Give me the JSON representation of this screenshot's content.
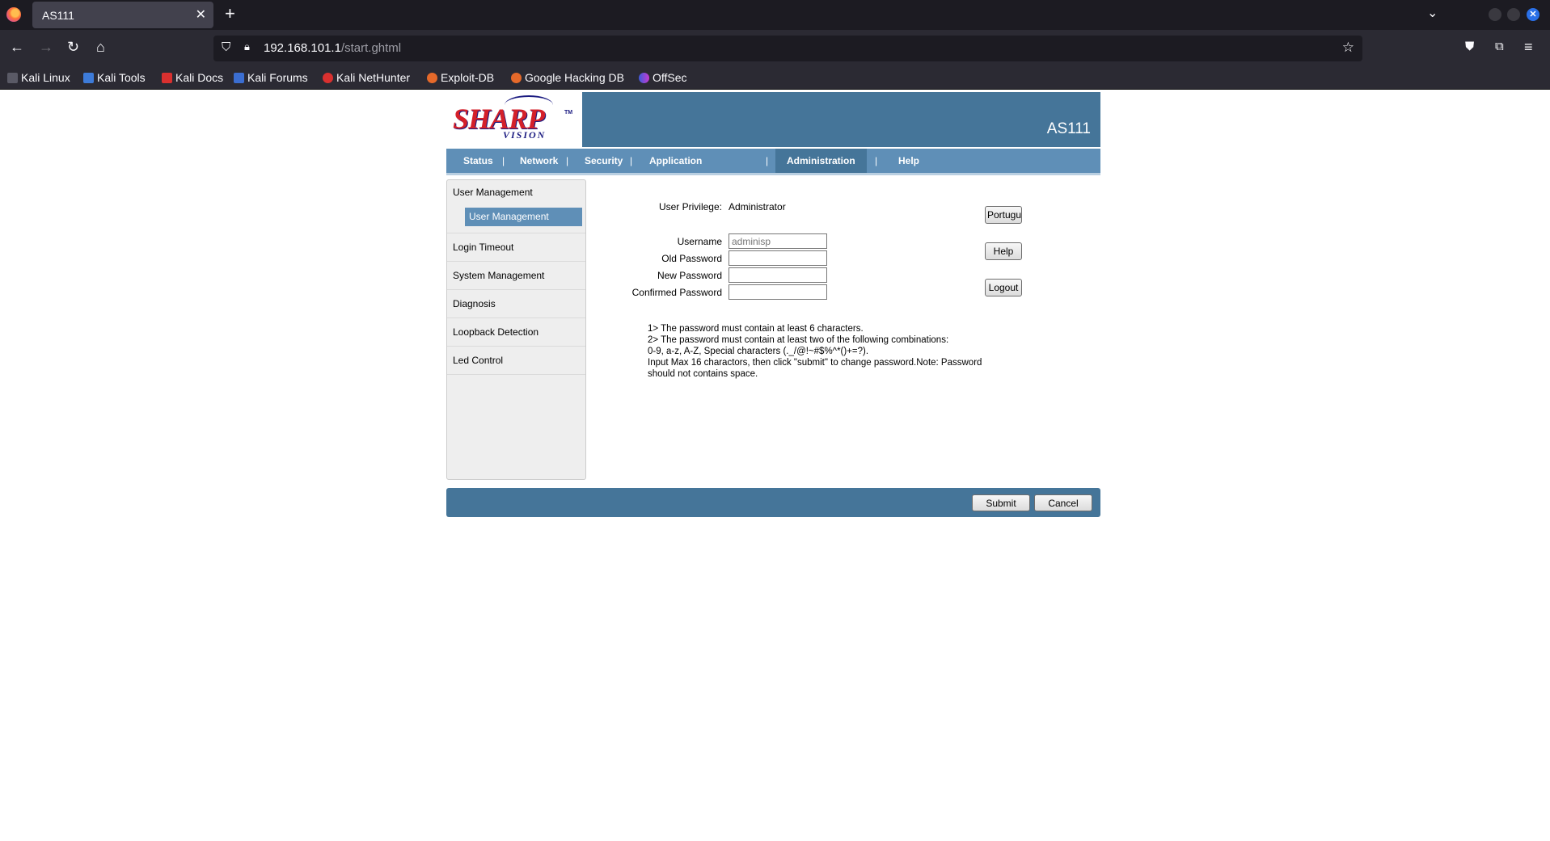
{
  "browser": {
    "tab_title": "AS111",
    "url_host": "192.168.101.1",
    "url_path": "/start.ghtml",
    "bookmarks": [
      "Kali Linux",
      "Kali Tools",
      "Kali Docs",
      "Kali Forums",
      "Kali NetHunter",
      "Exploit-DB",
      "Google Hacking DB",
      "OffSec"
    ]
  },
  "header": {
    "logo_text": "SHARP",
    "logo_sub": "VISION",
    "logo_tm": "TM",
    "model": "AS111"
  },
  "menu": {
    "items": [
      "Status",
      "Network",
      "Security",
      "Application",
      "Administration",
      "Help"
    ],
    "separator": "|",
    "active": "Administration"
  },
  "sidebar": {
    "group_title": "User Management",
    "sub_active": "User Management",
    "items": [
      "Login Timeout",
      "System Management",
      "Diagnosis",
      "Loopback Detection",
      "Led Control"
    ]
  },
  "form": {
    "privilege_label": "User Privilege:",
    "privilege_value": "Administrator",
    "username_label": "Username",
    "username_placeholder": "adminisp",
    "old_password_label": "Old Password",
    "new_password_label": "New Password",
    "confirmed_password_label": "Confirmed Password",
    "notes": [
      "1> The password must contain at least 6 characters.",
      "2> The password must contain at least two of the following combinations:",
      "0-9, a-z, A-Z, Special characters (._/@!~#$%^*()+=?).",
      "Input Max 16 charactors, then click \"submit\" to change password.Note: Password should not contains space."
    ]
  },
  "side_buttons": {
    "language": "Portuguese",
    "help": "Help",
    "logout": "Logout"
  },
  "footer": {
    "submit": "Submit",
    "cancel": "Cancel"
  }
}
